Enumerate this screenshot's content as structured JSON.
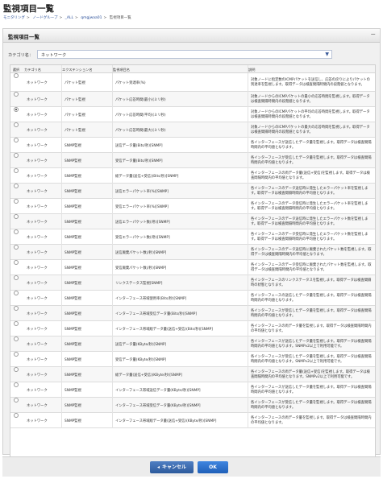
{
  "page": {
    "title": "監視項目一覧",
    "breadcrumb": [
      "モニタリング",
      "ノードグループ",
      "_ALL",
      "qmgjwaa01",
      "監視項目一覧"
    ]
  },
  "panel": {
    "title": "監視項目一覧",
    "collapse": "−",
    "category_label": "カテゴリ名：",
    "category_value": "ネットワーク"
  },
  "table": {
    "headers": [
      "選択",
      "カテゴリ名",
      "エクステンション名",
      "監視項目名",
      "説明"
    ],
    "rows": [
      {
        "cat": "ネットワーク",
        "ext": "パケット監視",
        "name": "パケット到達率(%)",
        "desc": "対象ノードに指定数のICMPパケットを送信し、応答の戻りによりパケットの到達率を監視します。取得データは検査間隔時間内の段階値となります。",
        "checked": false
      },
      {
        "cat": "ネットワーク",
        "ext": "パケット監視",
        "name": "パケット応答時間(最小)(ミリ秒)",
        "desc": "対象ノードからのICMPパケットの最小の応答時間を監視します。取得データは検査間隔時間内の段階値となります。",
        "checked": false
      },
      {
        "cat": "ネットワーク",
        "ext": "パケット監視",
        "name": "パケット応答時間(平均)(ミリ秒)",
        "desc": "対象ノードからのICMPパケットの平均の応答時間を監視します。取得データは検査間隔時間内の段階値となります。",
        "checked": true
      },
      {
        "cat": "ネットワーク",
        "ext": "パケット監視",
        "name": "パケット応答時間(最大)(ミリ秒)",
        "desc": "対象ノードからのICMPパケットの最大の応答時間を監視します。取得データは検査間隔時間内の段階値となります。",
        "checked": false
      },
      {
        "cat": "ネットワーク",
        "ext": "SNMP監視",
        "name": "送信データ量(Bits/秒)[SNMP]",
        "desc": "各インターフェースが送信したデータ量を監視します。取得データは検査間隔時間内の平均値となります。",
        "checked": false
      },
      {
        "cat": "ネットワーク",
        "ext": "SNMP監視",
        "name": "受信データ量(Bits/秒)[SNMP]",
        "desc": "各インターフェースが受信したデータ量を監視します。取得データは検査間隔時間内の平均値となります。",
        "checked": false
      },
      {
        "cat": "ネットワーク",
        "ext": "SNMP監視",
        "name": "総データ量(送信+受信)(Bits/秒)[SNMP]",
        "desc": "各インターフェースの両データ量(送信+受信)を監視します。取得データは検査間隔時間内の平均値となります。",
        "checked": false
      },
      {
        "cat": "ネットワーク",
        "ext": "SNMP監視",
        "name": "送信エラーパケット率(%)[SNMP]",
        "desc": "各インターフェースのデータ送信時に発生したエラーパケット率を監視します。取得データは検査間隔時間内の平均値となります。",
        "checked": false
      },
      {
        "cat": "ネットワーク",
        "ext": "SNMP監視",
        "name": "受信エラーパケット率(%)[SNMP]",
        "desc": "各インターフェースのデータ受信時に発生したエラーパケット率を監視します。取得データは検査間隔時間内の平均値となります。",
        "checked": false
      },
      {
        "cat": "ネットワーク",
        "ext": "SNMP監視",
        "name": "送信エラーパケット数(/秒)[SNMP]",
        "desc": "各インターフェースのデータ送信時に発生したエラーパケット数を監視します。取得データは検査間隔時間内の平均値となります。",
        "checked": false
      },
      {
        "cat": "ネットワーク",
        "ext": "SNMP監視",
        "name": "受信エラーパケット数(/秒)[SNMP]",
        "desc": "各インターフェースのデータ受信時に発生したエラーパケット数を監視します。取得データは検査間隔時間内の平均値となります。",
        "checked": false
      },
      {
        "cat": "ネットワーク",
        "ext": "SNMP監視",
        "name": "送信廃棄パケット数(/秒)[SNMP]",
        "desc": "各インターフェースのデータ送信時に廃棄されたパケット数を監視します。取得データは検査間隔時間内の平均値となります。",
        "checked": false
      },
      {
        "cat": "ネットワーク",
        "ext": "SNMP監視",
        "name": "受信廃棄パケット数(/秒)[SNMP]",
        "desc": "各インターフェースのデータ受信時に廃棄されたパケット数を監視します。取得データは検査間隔時間内の平均値となります。",
        "checked": false
      },
      {
        "cat": "ネットワーク",
        "ext": "SNMP監視",
        "name": "リンクステータス監視[SNMP]",
        "desc": "各インターフェースのリンクステータスを監視します。取得データは検査間隔時の状態となります。",
        "checked": false
      },
      {
        "cat": "ネットワーク",
        "ext": "SNMP監視",
        "name": "インターフェース帯域使用率(Bits/秒)[SNMP]",
        "desc": "各インターフェースの送信したデータ量を監視します。取得データは検査間隔時間内の平均値となります。",
        "checked": false
      },
      {
        "cat": "ネットワーク",
        "ext": "SNMP監視",
        "name": "インターフェース帯域受信データ量(Bits/秒)[SNMP]",
        "desc": "各インターフェースが受信したデータ量を監視します。取得データは検査間隔時間内の平均値となります。",
        "checked": false
      },
      {
        "cat": "ネットワーク",
        "ext": "SNMP監視",
        "name": "インターフェース帯域総データ量(送信+受信)(Bits/秒)[SNMP]",
        "desc": "各インターフェースの両データ量を監視します。取得データは検査間隔時間内の平均値となります。",
        "checked": false
      },
      {
        "cat": "ネットワーク",
        "ext": "SNMP監視",
        "name": "送信データ量(KByte/秒)[SNMP]",
        "desc": "各インターフェースが送信したデータ量を監視します。取得データは検査間隔時間内の平均値となります。SNMPv2以上で利用可能です。",
        "checked": false
      },
      {
        "cat": "ネットワーク",
        "ext": "SNMP監視",
        "name": "受信データ量(KByte/秒)[SNMP]",
        "desc": "各インターフェースが受信したデータ量を監視します。取得データは検査間隔時間内の平均値となります。SNMPv2以上で利用可能です。",
        "checked": false
      },
      {
        "cat": "ネットワーク",
        "ext": "SNMP監視",
        "name": "総データ量(送信+受信)(KByte/秒)[SNMP]",
        "desc": "各インターフェースの両データ量(送信+受信)を監視します。取得データは検査間隔時間内の平均値となります。SNMPv2以上で利用可能です。",
        "checked": false
      },
      {
        "cat": "ネットワーク",
        "ext": "SNMP監視",
        "name": "インターフェース帯域送信データ量(KByte/秒)[SNMP]",
        "desc": "各インターフェースが送信したデータ量を監視します。取得データは検査間隔時間内の平均値となります。",
        "checked": false
      },
      {
        "cat": "ネットワーク",
        "ext": "SNMP監視",
        "name": "インターフェース帯域受信データ量(KByte/秒)[SNMP]",
        "desc": "各インターフェースが受信したデータ量を監視します。取得データは検査間隔時間内の平均値となります。",
        "checked": false
      },
      {
        "cat": "ネットワーク",
        "ext": "SNMP監視",
        "name": "インターフェース帯域総データ量(送信+受信)(KByte/秒)[SNMP]",
        "desc": "各インターフェースの両データ量を監視します。取得データは検査間隔時間内の平均値となります。",
        "checked": false
      }
    ]
  },
  "footer": {
    "cancel_label": "キャンセル",
    "ok_label": "OK"
  }
}
